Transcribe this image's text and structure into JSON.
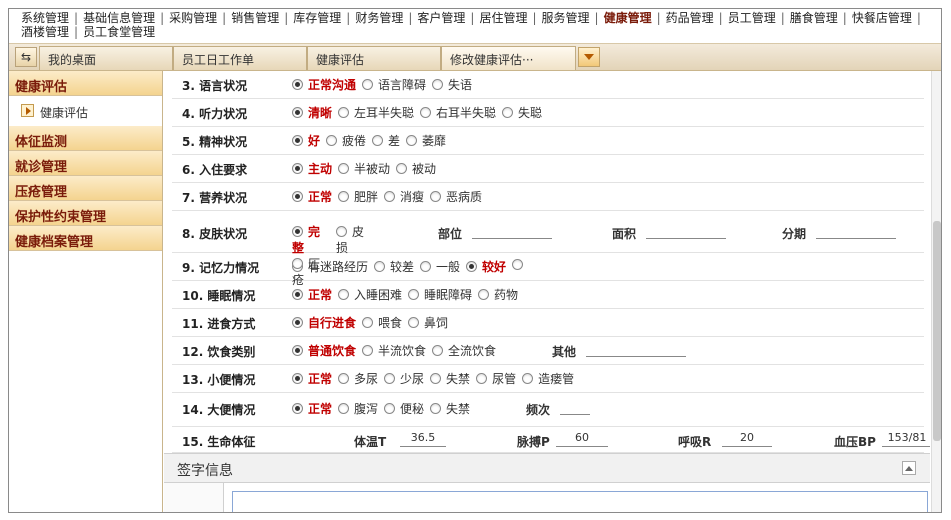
{
  "top_menu": {
    "items": [
      "系统管理",
      "基础信息管理",
      "采购管理",
      "销售管理",
      "库存管理",
      "财务管理",
      "客户管理",
      "居住管理",
      "服务管理",
      "健康管理",
      "药品管理",
      "员工管理",
      "膳食管理",
      "快餐店管理",
      "酒楼管理",
      "员工食堂管理"
    ],
    "active": "健康管理"
  },
  "tabs": {
    "items": [
      "我的桌面",
      "员工日工作单",
      "健康评估",
      "修改健康评估···"
    ]
  },
  "sidebar": {
    "head": "健康评估",
    "sub": "健康评估",
    "items": [
      "体征监测",
      "就诊管理",
      "压疮管理",
      "保护性约束管理",
      "健康档案管理"
    ]
  },
  "form": {
    "rows": [
      {
        "label": "3. 语言状况",
        "options": [
          {
            "text": "正常沟通",
            "selected": true
          },
          {
            "text": "语言障碍",
            "selected": false
          },
          {
            "text": "失语",
            "selected": false
          }
        ]
      },
      {
        "label": "4. 听力状况",
        "options": [
          {
            "text": "清晰",
            "selected": true
          },
          {
            "text": "左耳半失聪",
            "selected": false
          },
          {
            "text": "右耳半失聪",
            "selected": false
          },
          {
            "text": "失聪",
            "selected": false
          }
        ]
      },
      {
        "label": "5. 精神状况",
        "options": [
          {
            "text": "好",
            "selected": true
          },
          {
            "text": "疲倦",
            "selected": false
          },
          {
            "text": "差",
            "selected": false
          },
          {
            "text": "萎靡",
            "selected": false
          }
        ]
      },
      {
        "label": "6. 入住要求",
        "options": [
          {
            "text": "主动",
            "selected": true
          },
          {
            "text": "半被动",
            "selected": false
          },
          {
            "text": "被动",
            "selected": false
          }
        ]
      },
      {
        "label": "7. 营养状况",
        "options": [
          {
            "text": "正常",
            "selected": true
          },
          {
            "text": "肥胖",
            "selected": false
          },
          {
            "text": "消瘦",
            "selected": false
          },
          {
            "text": "恶病质",
            "selected": false
          }
        ]
      },
      {
        "label": "8. 皮肤状况",
        "options": [
          {
            "text": "完整",
            "selected": true
          },
          {
            "text": "皮损",
            "selected": false
          },
          {
            "text": "压疮",
            "selected": false
          }
        ],
        "fields": [
          "部位",
          "面积",
          "分期"
        ]
      },
      {
        "label": "9. 记忆力情况",
        "options": [
          {
            "text": "有迷路经历",
            "selected": false
          },
          {
            "text": "较差",
            "selected": false
          },
          {
            "text": "一般",
            "selected": false
          },
          {
            "text": "较好",
            "selected": true
          },
          {
            "text": "",
            "selected": false
          }
        ]
      },
      {
        "label": "10. 睡眠情况",
        "options": [
          {
            "text": "正常",
            "selected": true
          },
          {
            "text": "入睡困难",
            "selected": false
          },
          {
            "text": "睡眠障碍",
            "selected": false
          },
          {
            "text": "药物",
            "selected": false
          }
        ]
      },
      {
        "label": "11. 进食方式",
        "options": [
          {
            "text": "自行进食",
            "selected": true
          },
          {
            "text": "喂食",
            "selected": false
          },
          {
            "text": "鼻饲",
            "selected": false
          }
        ]
      },
      {
        "label": "12. 饮食类别",
        "options": [
          {
            "text": "普通饮食",
            "selected": true
          },
          {
            "text": "半流饮食",
            "selected": false
          },
          {
            "text": "全流饮食",
            "selected": false
          }
        ],
        "fields": [
          "其他"
        ]
      },
      {
        "label": "13. 小便情况",
        "options": [
          {
            "text": "正常",
            "selected": true
          },
          {
            "text": "多尿",
            "selected": false
          },
          {
            "text": "少尿",
            "selected": false
          },
          {
            "text": "失禁",
            "selected": false
          },
          {
            "text": "尿管",
            "selected": false
          },
          {
            "text": "造瘘管",
            "selected": false
          }
        ]
      },
      {
        "label": "14. 大便情况",
        "options": [
          {
            "text": "正常",
            "selected": true
          },
          {
            "text": "腹泻",
            "selected": false
          },
          {
            "text": "便秘",
            "selected": false
          },
          {
            "text": "失禁",
            "selected": false
          }
        ],
        "fields": [
          "频次"
        ]
      }
    ],
    "vitals": {
      "label": "15. 生命体征",
      "temp_label": "体温T",
      "temp": "36.5",
      "pulse_label": "脉搏P",
      "pulse": "60",
      "resp_label": "呼吸R",
      "resp": "20",
      "bp_label": "血压BP",
      "bp": "153/81"
    }
  },
  "sign": {
    "title": "签字信息"
  },
  "colors": {
    "accent": "#7a1b0a",
    "selected_text": "#c00000",
    "sidebar_bg": "#f4d48f"
  }
}
